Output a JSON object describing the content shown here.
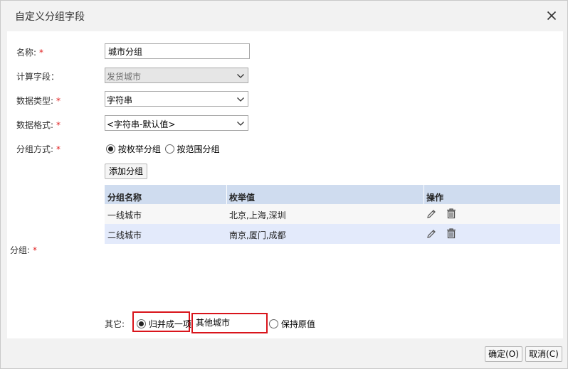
{
  "dialog": {
    "title": "自定义分组字段",
    "close_icon": "close-icon"
  },
  "form": {
    "name_label": "名称:",
    "name_value": "城市分组",
    "calc_label": "计算字段：",
    "calc_value": "发货城市",
    "type_label": "数据类型:",
    "type_value": "字符串",
    "format_label": "数据格式:",
    "format_value": "<字符串-默认值>",
    "method_label": "分组方式:",
    "method_options": [
      "按枚举分组",
      "按范围分组"
    ],
    "method_selected": "按枚举分组",
    "required_mark": "*"
  },
  "groups": {
    "add_button": "添加分组",
    "side_label": "分组:",
    "columns": [
      "分组名称",
      "枚举值",
      "操作"
    ],
    "rows": [
      {
        "name": "一线城市",
        "values": "北京,上海,深圳"
      },
      {
        "name": "二线城市",
        "values": "南京,厦门,成都"
      }
    ],
    "row_icons": [
      "edit-icon",
      "delete-icon"
    ]
  },
  "other": {
    "label": "其它:",
    "merge_label": "归并成一项",
    "merge_value": "其他城市",
    "keep_label": "保持原值",
    "selected": "归并成一项",
    "highlight_color": "#d9141b"
  },
  "footer": {
    "ok": "确定(O)",
    "cancel": "取消(C)"
  }
}
